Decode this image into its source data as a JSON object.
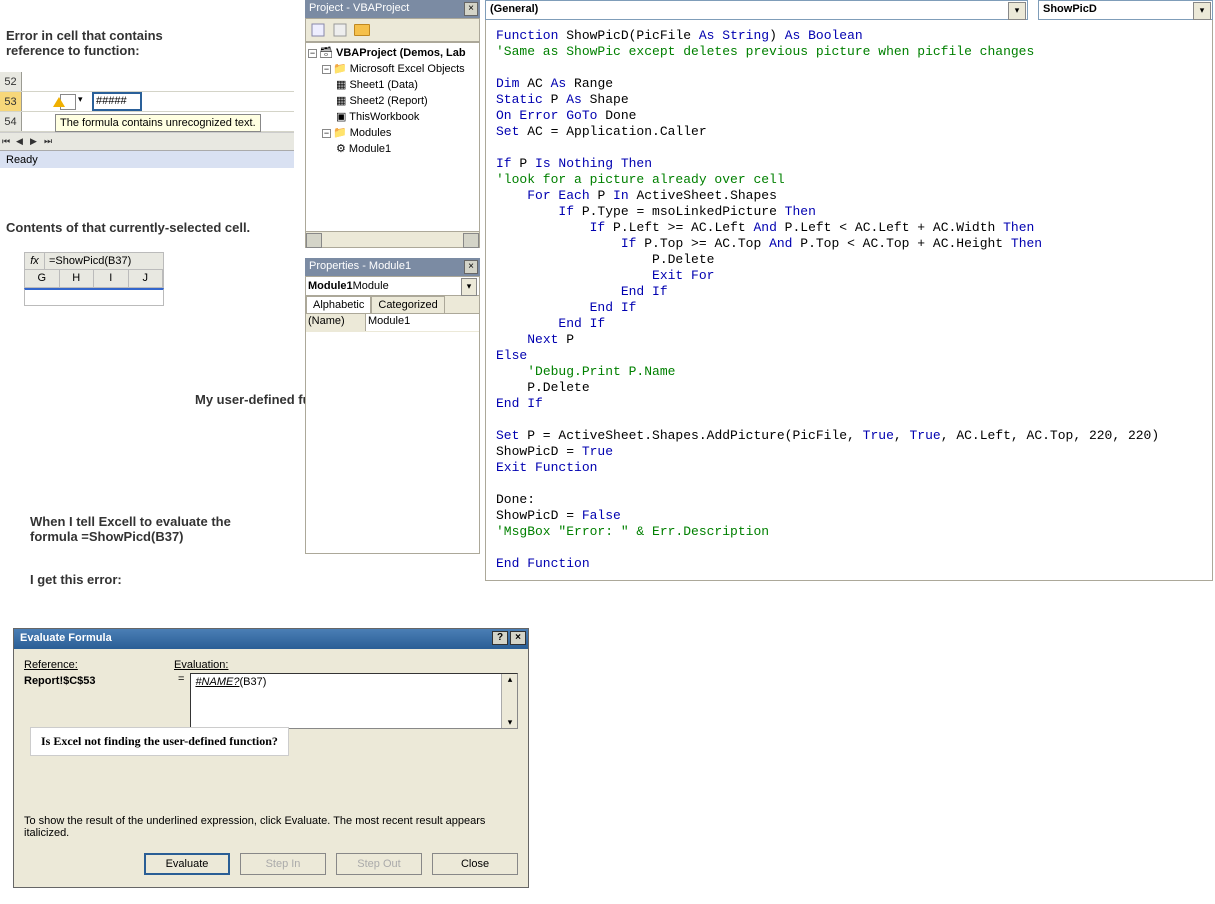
{
  "annotations": {
    "a1": "Error in cell that contains reference to function:",
    "a2": "Contents of that currently-selected cell.",
    "a3": "My user-defined function -->",
    "a4": "When I tell Excell to evaluate the formula   =ShowPicd(B37)",
    "a5": "I get this error:",
    "callout": "Is Excel not finding the user-defined function?"
  },
  "excel1": {
    "rows": [
      "52",
      "53",
      "54"
    ],
    "err_value": "#####",
    "tooltip": "The formula contains unrecognized text.",
    "status": "Ready"
  },
  "excel2": {
    "fx": "fx",
    "formula": "=ShowPicd(B37)",
    "cols": [
      "G",
      "H",
      "I",
      "J"
    ]
  },
  "vba": {
    "project_title": "Project - VBAProject",
    "root": "VBAProject (Demos, Lab",
    "excel_objs": "Microsoft Excel Objects",
    "sheet1": "Sheet1 (Data)",
    "sheet2": "Sheet2 (Report)",
    "thiswb": "ThisWorkbook",
    "modules": "Modules",
    "module1": "Module1",
    "props_title": "Properties - Module1",
    "combo": "Module1",
    "combo_suffix": " Module",
    "tab1": "Alphabetic",
    "tab2": "Categorized",
    "prop_name": "(Name)",
    "prop_val": "Module1"
  },
  "code": {
    "dd1": "(General)",
    "dd2": "ShowPicD",
    "lines": [
      {
        "t": "kw",
        "s": "Function"
      },
      {
        "t": "",
        "s": " ShowPicD(PicFile "
      },
      {
        "t": "kw",
        "s": "As String"
      },
      {
        "t": "",
        "s": ") "
      },
      {
        "t": "kw",
        "s": "As Boolean"
      },
      {
        "t": "nl",
        "s": ""
      },
      {
        "t": "cm",
        "s": "'Same as ShowPic except deletes previous picture when picfile changes"
      },
      {
        "t": "nl",
        "s": ""
      },
      {
        "t": "nl",
        "s": ""
      },
      {
        "t": "kw",
        "s": "Dim"
      },
      {
        "t": "",
        "s": " AC "
      },
      {
        "t": "kw",
        "s": "As"
      },
      {
        "t": "",
        "s": " Range"
      },
      {
        "t": "nl",
        "s": ""
      },
      {
        "t": "kw",
        "s": "Static"
      },
      {
        "t": "",
        "s": " P "
      },
      {
        "t": "kw",
        "s": "As"
      },
      {
        "t": "",
        "s": " Shape"
      },
      {
        "t": "nl",
        "s": ""
      },
      {
        "t": "kw",
        "s": "On Error GoTo"
      },
      {
        "t": "",
        "s": " Done"
      },
      {
        "t": "nl",
        "s": ""
      },
      {
        "t": "kw",
        "s": "Set"
      },
      {
        "t": "",
        "s": " AC = Application.Caller"
      },
      {
        "t": "nl",
        "s": ""
      },
      {
        "t": "nl",
        "s": ""
      },
      {
        "t": "kw",
        "s": "If"
      },
      {
        "t": "",
        "s": " P "
      },
      {
        "t": "kw",
        "s": "Is Nothing Then"
      },
      {
        "t": "nl",
        "s": ""
      },
      {
        "t": "cm",
        "s": "'look for a picture already over cell"
      },
      {
        "t": "nl",
        "s": ""
      },
      {
        "t": "",
        "s": "    "
      },
      {
        "t": "kw",
        "s": "For Each"
      },
      {
        "t": "",
        "s": " P "
      },
      {
        "t": "kw",
        "s": "In"
      },
      {
        "t": "",
        "s": " ActiveSheet.Shapes"
      },
      {
        "t": "nl",
        "s": ""
      },
      {
        "t": "",
        "s": "        "
      },
      {
        "t": "kw",
        "s": "If"
      },
      {
        "t": "",
        "s": " P.Type = msoLinkedPicture "
      },
      {
        "t": "kw",
        "s": "Then"
      },
      {
        "t": "nl",
        "s": ""
      },
      {
        "t": "",
        "s": "            "
      },
      {
        "t": "kw",
        "s": "If"
      },
      {
        "t": "",
        "s": " P.Left >= AC.Left "
      },
      {
        "t": "kw",
        "s": "And"
      },
      {
        "t": "",
        "s": " P.Left < AC.Left + AC.Width "
      },
      {
        "t": "kw",
        "s": "Then"
      },
      {
        "t": "nl",
        "s": ""
      },
      {
        "t": "",
        "s": "                "
      },
      {
        "t": "kw",
        "s": "If"
      },
      {
        "t": "",
        "s": " P.Top >= AC.Top "
      },
      {
        "t": "kw",
        "s": "And"
      },
      {
        "t": "",
        "s": " P.Top < AC.Top + AC.Height "
      },
      {
        "t": "kw",
        "s": "Then"
      },
      {
        "t": "nl",
        "s": ""
      },
      {
        "t": "",
        "s": "                    P.Delete"
      },
      {
        "t": "nl",
        "s": ""
      },
      {
        "t": "",
        "s": "                    "
      },
      {
        "t": "kw",
        "s": "Exit For"
      },
      {
        "t": "nl",
        "s": ""
      },
      {
        "t": "",
        "s": "                "
      },
      {
        "t": "kw",
        "s": "End If"
      },
      {
        "t": "nl",
        "s": ""
      },
      {
        "t": "",
        "s": "            "
      },
      {
        "t": "kw",
        "s": "End If"
      },
      {
        "t": "nl",
        "s": ""
      },
      {
        "t": "",
        "s": "        "
      },
      {
        "t": "kw",
        "s": "End If"
      },
      {
        "t": "nl",
        "s": ""
      },
      {
        "t": "",
        "s": "    "
      },
      {
        "t": "kw",
        "s": "Next"
      },
      {
        "t": "",
        "s": " P"
      },
      {
        "t": "nl",
        "s": ""
      },
      {
        "t": "kw",
        "s": "Else"
      },
      {
        "t": "nl",
        "s": ""
      },
      {
        "t": "",
        "s": "    "
      },
      {
        "t": "cm",
        "s": "'Debug.Print P.Name"
      },
      {
        "t": "nl",
        "s": ""
      },
      {
        "t": "",
        "s": "    P.Delete"
      },
      {
        "t": "nl",
        "s": ""
      },
      {
        "t": "kw",
        "s": "End If"
      },
      {
        "t": "nl",
        "s": ""
      },
      {
        "t": "nl",
        "s": ""
      },
      {
        "t": "kw",
        "s": "Set"
      },
      {
        "t": "",
        "s": " P = ActiveSheet.Shapes.AddPicture(PicFile, "
      },
      {
        "t": "kw",
        "s": "True"
      },
      {
        "t": "",
        "s": ", "
      },
      {
        "t": "kw",
        "s": "True"
      },
      {
        "t": "",
        "s": ", AC.Left, AC.Top, 220, 220)"
      },
      {
        "t": "nl",
        "s": ""
      },
      {
        "t": "",
        "s": "ShowPicD = "
      },
      {
        "t": "kw",
        "s": "True"
      },
      {
        "t": "nl",
        "s": ""
      },
      {
        "t": "kw",
        "s": "Exit Function"
      },
      {
        "t": "nl",
        "s": ""
      },
      {
        "t": "nl",
        "s": ""
      },
      {
        "t": "",
        "s": "Done:"
      },
      {
        "t": "nl",
        "s": ""
      },
      {
        "t": "",
        "s": "ShowPicD = "
      },
      {
        "t": "kw",
        "s": "False"
      },
      {
        "t": "nl",
        "s": ""
      },
      {
        "t": "cm",
        "s": "'MsgBox \"Error: \" & Err.Description"
      },
      {
        "t": "nl",
        "s": ""
      },
      {
        "t": "nl",
        "s": ""
      },
      {
        "t": "kw",
        "s": "End Function"
      }
    ]
  },
  "eval": {
    "title": "Evaluate Formula",
    "ref_label": "Reference:",
    "eval_label": "Evaluation:",
    "ref": "Report!$C$53",
    "eq": "=",
    "expr_err": "#NAME?",
    "expr_rest": "(B37)",
    "hint": "To show the result of the underlined expression, click Evaluate.  The most recent result appears italicized.",
    "btn_eval": "Evaluate",
    "btn_in": "Step In",
    "btn_out": "Step Out",
    "btn_close": "Close"
  }
}
